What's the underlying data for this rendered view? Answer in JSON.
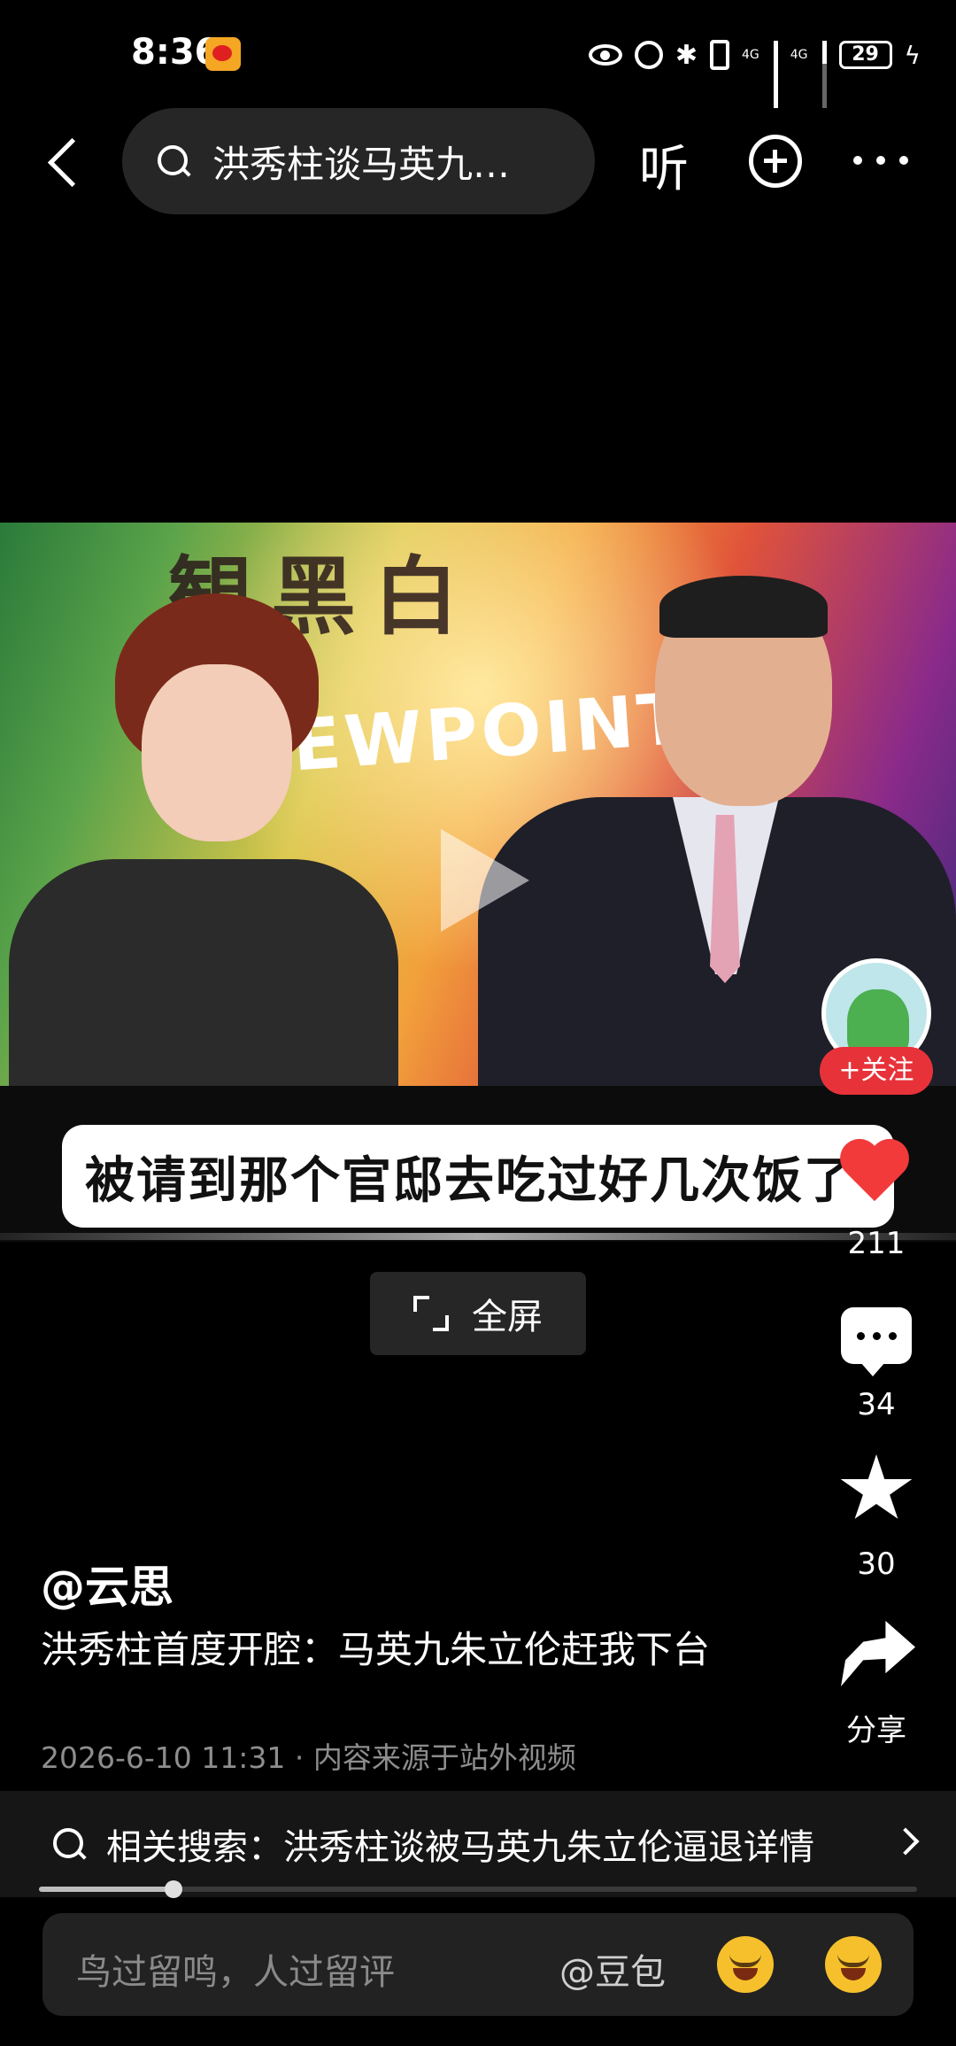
{
  "status_bar": {
    "time": "8:36",
    "net1": "4G",
    "net2": "4G",
    "battery": "29",
    "icons": [
      "weibo-badge-icon",
      "eye-icon",
      "alarm-icon",
      "bluetooth-icon",
      "vibrate-icon",
      "signal-icon",
      "battery-icon",
      "charging-icon"
    ]
  },
  "nav": {
    "search_text": "洪秀柱谈马英九…",
    "listen_label": "听"
  },
  "video": {
    "brush_text": "観黑白",
    "banner_text": "EWPOINT",
    "subtitle": "被请到那个官邸去吃过好几次饭了"
  },
  "fullscreen_label": "全屏",
  "actions": {
    "follow_label": "+关注",
    "like_count": "211",
    "comment_count": "34",
    "favorite_count": "30",
    "share_label": "分享"
  },
  "post": {
    "author": "@云思",
    "title": "洪秀柱首度开腔：马英九朱立伦赶我下台",
    "meta": "2026-6-10 11:31 · 内容来源于站外视频"
  },
  "related": {
    "text": "相关搜索：洪秀柱谈被马英九朱立伦逼退详情"
  },
  "playback": {
    "progress": 0.153
  },
  "comment": {
    "placeholder": "鸟过留鸣，人过留评",
    "mention": "@豆包"
  },
  "colors": {
    "background": "#000000",
    "follow_red": "#e8323a",
    "heart_red": "#f23a3a",
    "meta_gray": "#8d8d8d"
  }
}
